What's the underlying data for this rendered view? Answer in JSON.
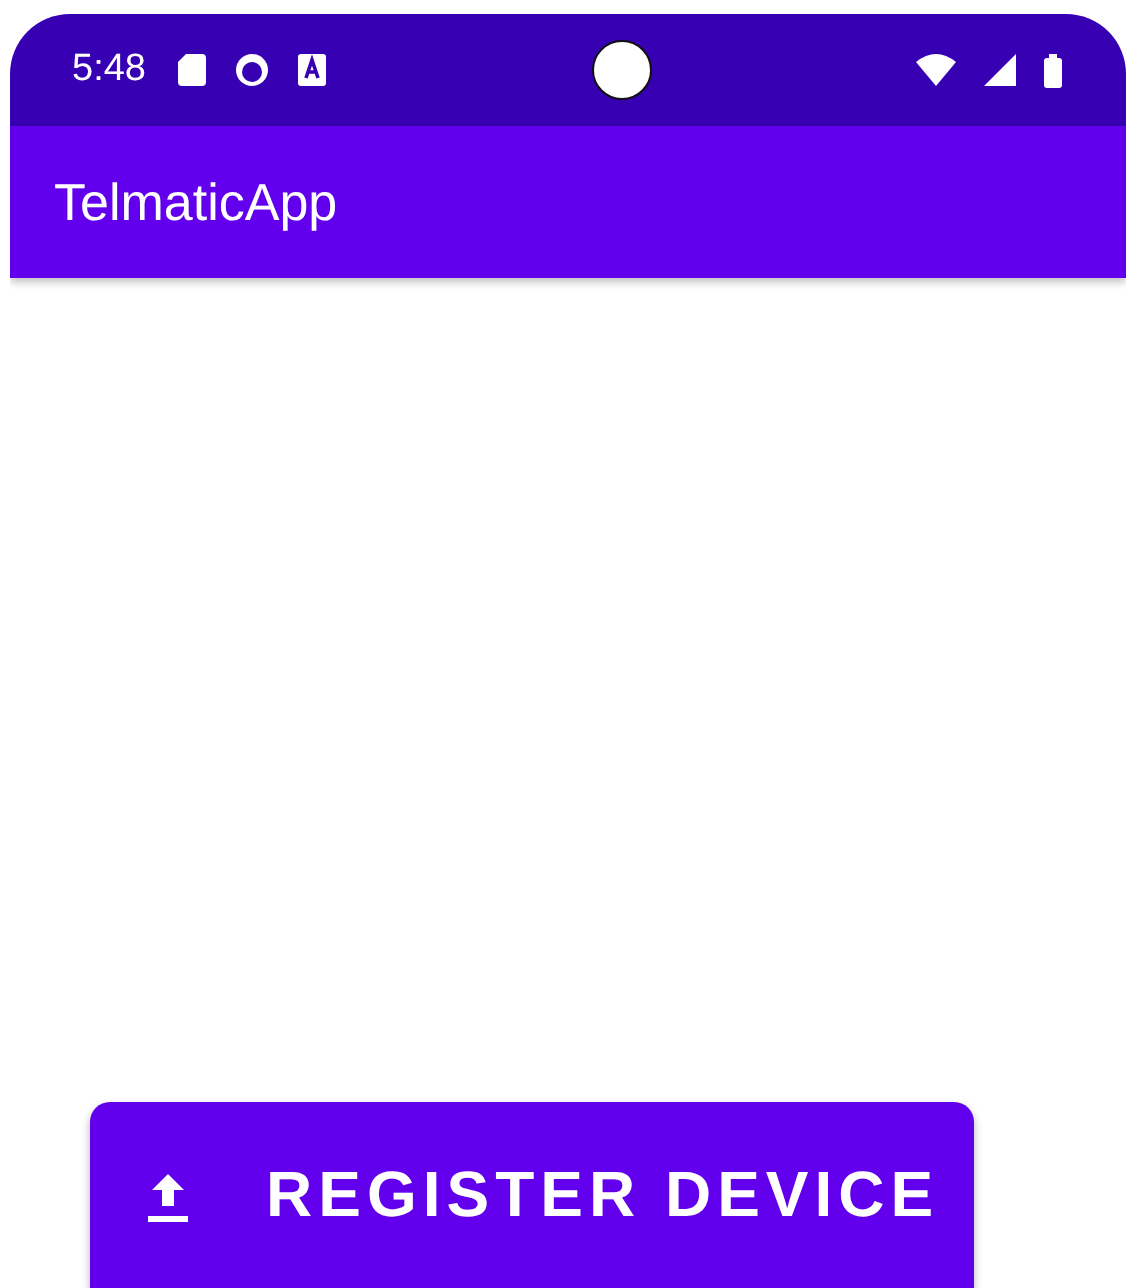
{
  "status_bar": {
    "time": "5:48"
  },
  "app_bar": {
    "title": "TelmaticApp"
  },
  "button": {
    "label": "REGISTER DEVICE"
  }
}
